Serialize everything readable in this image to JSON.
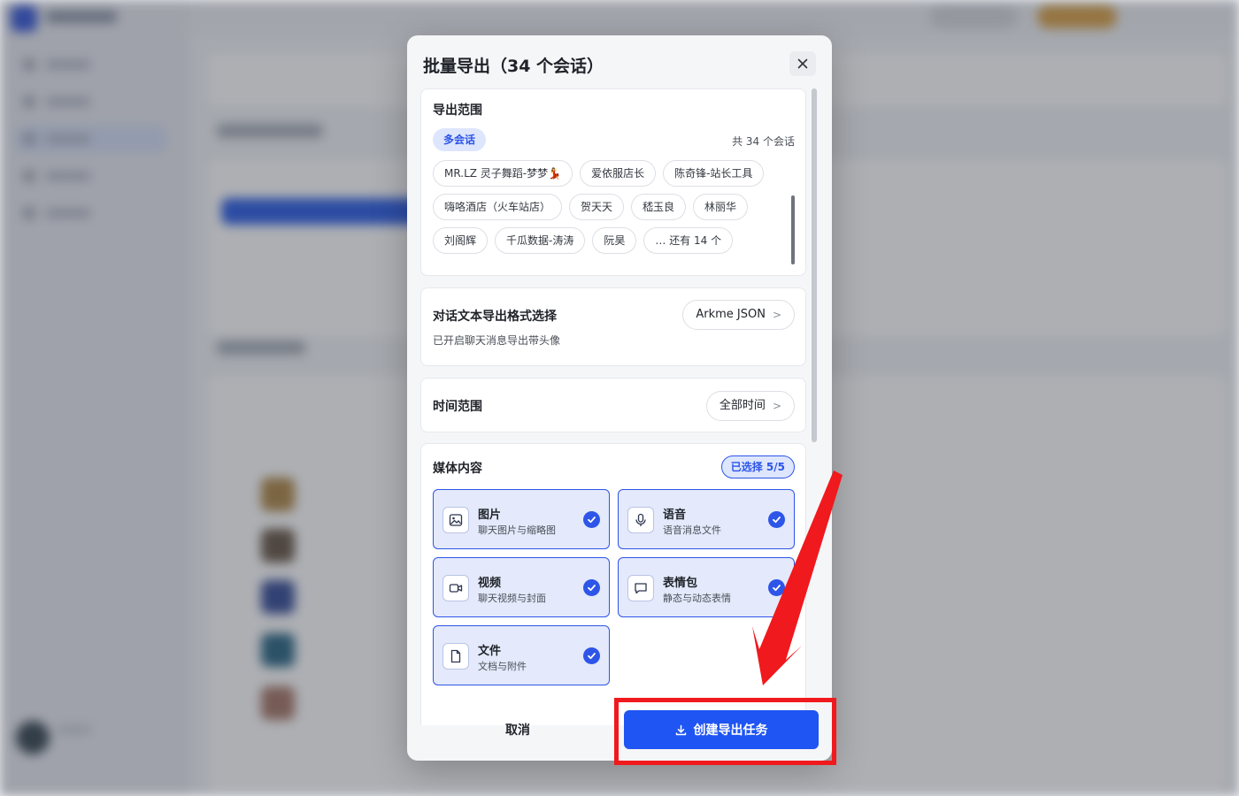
{
  "dialog": {
    "title": "批量导出（34 个会话）",
    "close_label": "×"
  },
  "scope": {
    "title": "导出范围",
    "badge": "多会话",
    "total": "共 34 个会话",
    "chip_rows": [
      [
        "MR.LZ 灵子舞蹈-梦梦💃",
        "爱依服店长",
        "陈奇锋-站长工具"
      ],
      [
        "嗨咯酒店（火车站店）",
        "贺天天",
        "嵇玉良",
        "林丽华"
      ],
      [
        "刘阁辉",
        "千瓜数据-涛涛",
        "阮昊"
      ]
    ],
    "more_label": "… 还有 14 个"
  },
  "format": {
    "title": "对话文本导出格式选择",
    "value": "Arkme JSON",
    "sub": "已开启聊天消息导出带头像",
    "chevron": ">"
  },
  "time_range": {
    "title": "时间范围",
    "value": "全部时间",
    "chevron": ">"
  },
  "media": {
    "title": "媒体内容",
    "selected_badge": "已选择 5/5",
    "items": [
      {
        "name": "图片",
        "desc": "聊天图片与缩略图",
        "icon": "image-icon"
      },
      {
        "name": "语音",
        "desc": "语音消息文件",
        "icon": "microphone-icon"
      },
      {
        "name": "视频",
        "desc": "聊天视频与封面",
        "icon": "video-icon"
      },
      {
        "name": "表情包",
        "desc": "静态与动态表情",
        "icon": "chat-bubble-icon"
      },
      {
        "name": "文件",
        "desc": "文档与附件",
        "icon": "document-icon"
      }
    ]
  },
  "footer": {
    "cancel": "取消",
    "create": "创建导出任务",
    "create_icon": "download-icon"
  },
  "colors": {
    "primary": "#1f55f2",
    "annotation": "#f0191d",
    "selected_bg": "#e4e9fb"
  }
}
